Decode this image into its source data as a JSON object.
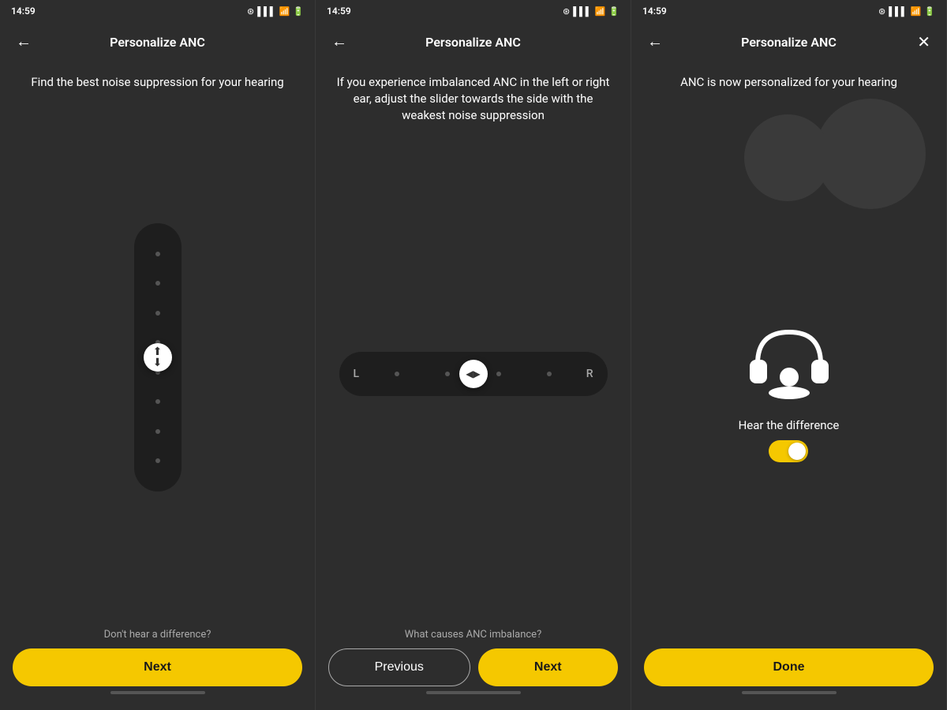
{
  "panels": [
    {
      "id": "panel-1",
      "statusBar": {
        "time": "14:59",
        "icons": "🔔 📶 🔋"
      },
      "header": {
        "title": "Personalize ANC",
        "backIcon": "←",
        "hasClose": false
      },
      "description": "Find the best noise suppression for your hearing",
      "footerLink": "Don't hear a difference?",
      "buttons": [
        {
          "id": "next-btn-1",
          "label": "Next",
          "type": "next"
        }
      ]
    },
    {
      "id": "panel-2",
      "statusBar": {
        "time": "14:59",
        "icons": "🔔 📶 🔋"
      },
      "header": {
        "title": "Personalize ANC",
        "backIcon": "←",
        "hasClose": false
      },
      "description": "If you experience imbalanced ANC in the left or right ear, adjust the slider towards the side with the weakest noise suppression",
      "footerLink": "What causes ANC imbalance?",
      "buttons": [
        {
          "id": "prev-btn-2",
          "label": "Previous",
          "type": "prev"
        },
        {
          "id": "next-btn-2",
          "label": "Next",
          "type": "next"
        }
      ]
    },
    {
      "id": "panel-3",
      "statusBar": {
        "time": "14:59",
        "icons": "🔔 📶 🔋"
      },
      "header": {
        "title": "Personalize ANC",
        "backIcon": "←",
        "hasClose": true,
        "closeIcon": "✕"
      },
      "description": "ANC is now personalized for your hearing",
      "hearDiff": {
        "label": "Hear the difference",
        "toggleOn": true
      },
      "buttons": [
        {
          "id": "done-btn-3",
          "label": "Done",
          "type": "done"
        }
      ]
    }
  ],
  "slider": {
    "leftLabel": "L",
    "rightLabel": "R"
  }
}
